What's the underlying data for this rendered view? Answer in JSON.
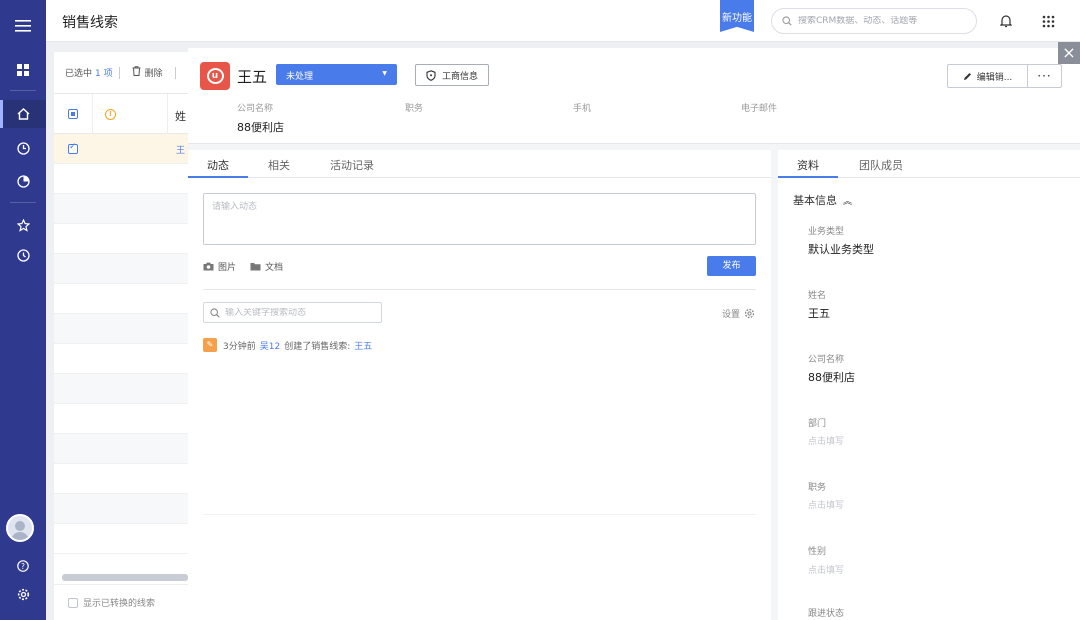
{
  "topbar": {
    "title": "销售线索",
    "new_feature": "新功能",
    "search_placeholder": "搜索CRM数据、动态、话题等"
  },
  "list": {
    "selected_prefix": "已选中",
    "selected_count": "1 项",
    "delete_label": "删除",
    "column_name_partial": "姓",
    "row_name_partial": "王",
    "show_converted": "显示已转换的线索"
  },
  "detail": {
    "name": "王五",
    "status": "未处理",
    "biz_info_button": "工商信息",
    "edit_button": "编辑销...",
    "more_button": "···",
    "fields": {
      "company_label": "公司名称",
      "position_label": "职务",
      "mobile_label": "手机",
      "email_label": "电子邮件",
      "company_value": "88便利店"
    }
  },
  "activity": {
    "tabs": [
      "动态",
      "相关",
      "活动记录"
    ],
    "input_placeholder": "请输入动态",
    "attach_image": "图片",
    "attach_doc": "文档",
    "publish": "发布",
    "search_placeholder": "输入关键字搜索动态",
    "settings": "设置",
    "feed": {
      "time": "3分钟前",
      "user": "吴12",
      "action": "创建了销售线索:",
      "target": "王五"
    }
  },
  "profile": {
    "tabs": [
      "资料",
      "团队成员"
    ],
    "section_title": "基本信息",
    "fields": [
      {
        "label": "业务类型",
        "value": "默认业务类型"
      },
      {
        "label": "姓名",
        "value": "王五"
      },
      {
        "label": "公司名称",
        "value": "88便利店"
      },
      {
        "label": "部门",
        "value": "点击填写"
      },
      {
        "label": "职务",
        "value": "点击填写"
      },
      {
        "label": "性别",
        "value": "点击填写"
      },
      {
        "label": "跟进状态",
        "value": ""
      }
    ]
  },
  "colors": {
    "nav_bg": "#2f3a8f",
    "accent": "#4a7bea",
    "logo": "#e8564a",
    "warning": "#f5a623"
  }
}
